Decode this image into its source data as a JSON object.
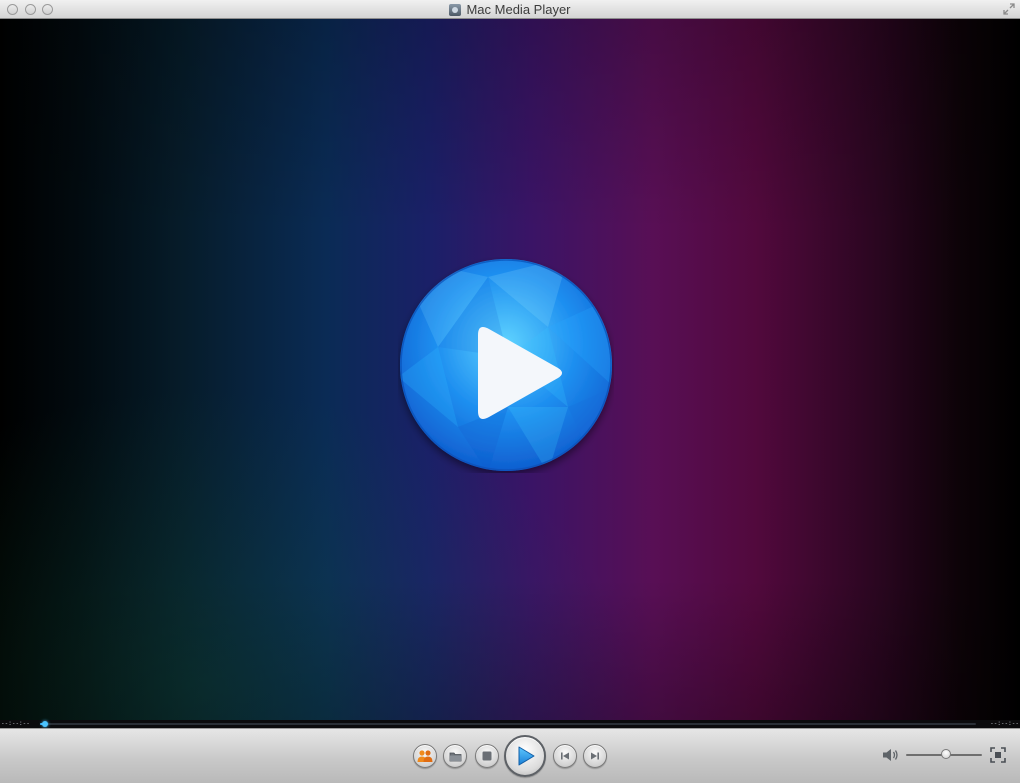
{
  "window": {
    "title": "Mac Media Player",
    "title_icon": "media-player-app-icon"
  },
  "video": {
    "overlay_icon": "play-icon",
    "colors": {
      "play_button_blue": "#1e8ff0",
      "play_button_light": "#6ad6ff"
    }
  },
  "progress": {
    "elapsed": "--:--:--",
    "remaining": "--:--:--",
    "value": 0.005,
    "accent": "#39b4ff"
  },
  "controls": {
    "buttons": [
      {
        "name": "people-icon"
      },
      {
        "name": "folder-icon"
      },
      {
        "name": "stop-icon"
      },
      {
        "name": "play-icon"
      },
      {
        "name": "previous-icon"
      },
      {
        "name": "next-icon"
      }
    ],
    "volume": {
      "icon": "speaker-icon",
      "level": 0.52
    },
    "fullscreen_icon": "fullscreen-icon"
  }
}
